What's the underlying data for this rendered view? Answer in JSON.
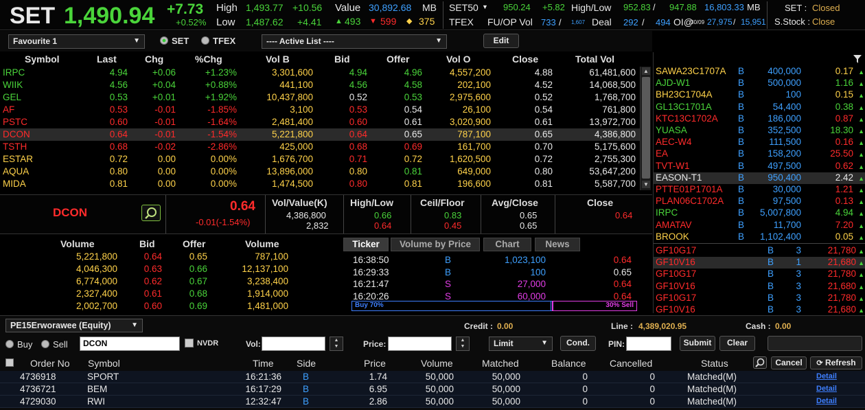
{
  "top": {
    "set_label": "SET",
    "index": "1,490.94",
    "chg": "+7.73",
    "pchg": "+0.52%",
    "high_label": "High",
    "high": "1,493.77",
    "high_chg": "+10.56",
    "low_label": "Low",
    "low": "1,487.62",
    "low_chg": "+4.41",
    "value_label": "Value",
    "value": "30,892.68",
    "mb": "MB",
    "up": "493",
    "down": "599",
    "unch": "375",
    "set50_label": "SET50",
    "set50": "950.24",
    "set50_chg": "+5.82",
    "hl_label": "High/Low",
    "set50_high": "952.83",
    "set50_low": "947.88",
    "set50_value": "16,803.33",
    "set50_mb": "MB",
    "tfex_label": "TFEX",
    "fuop_label": "FU/OP Vol",
    "fuop_vol": "733",
    "fuop_small": "1,607",
    "deal_label": "Deal",
    "deal1": "292",
    "deal2": "494",
    "oi_label": "OI@",
    "oi_date": "30/09",
    "oi1": "27,975",
    "oi2": "15,951",
    "set_status_label": "SET :",
    "set_status": "Closed",
    "sstock_label": "S.Stock :",
    "sstock_status": "Close"
  },
  "toolbar": {
    "favourite": "Favourite 1",
    "set": "SET",
    "tfex": "TFEX",
    "active_list": "---- Active List ----",
    "edit": "Edit"
  },
  "watch": {
    "headers": [
      "Symbol",
      "Last",
      "Chg",
      "%Chg",
      "Vol B",
      "Bid",
      "Offer",
      "Vol O",
      "Close",
      "Total Vol"
    ],
    "rows": [
      {
        "sym": "IRPC",
        "last": "4.94",
        "chg": "+0.06",
        "pchg": "+1.23%",
        "volb": "3,301,600",
        "bid": "4.94",
        "offer": "4.96",
        "volo": "4,557,200",
        "close": "4.88",
        "total": "61,481,600",
        "c": "g",
        "bc": "g",
        "oc": "g"
      },
      {
        "sym": "WIIK",
        "last": "4.56",
        "chg": "+0.04",
        "pchg": "+0.88%",
        "volb": "441,100",
        "bid": "4.56",
        "offer": "4.58",
        "volo": "202,100",
        "close": "4.52",
        "total": "14,068,500",
        "c": "g",
        "bc": "g",
        "oc": "g"
      },
      {
        "sym": "GEL",
        "last": "0.53",
        "chg": "+0.01",
        "pchg": "+1.92%",
        "volb": "10,437,800",
        "bid": "0.52",
        "offer": "0.53",
        "volo": "2,975,600",
        "close": "0.52",
        "total": "1,768,700",
        "c": "g",
        "bc": "w",
        "oc": "g"
      },
      {
        "sym": "AF",
        "last": "0.53",
        "chg": "-0.01",
        "pchg": "-1.85%",
        "volb": "3,100",
        "bid": "0.53",
        "offer": "0.54",
        "volo": "26,100",
        "close": "0.54",
        "total": "761,800",
        "c": "r",
        "bc": "r",
        "oc": "w"
      },
      {
        "sym": "PSTC",
        "last": "0.60",
        "chg": "-0.01",
        "pchg": "-1.64%",
        "volb": "2,481,400",
        "bid": "0.60",
        "offer": "0.61",
        "volo": "3,020,900",
        "close": "0.61",
        "total": "13,972,700",
        "c": "r",
        "bc": "r",
        "oc": "w"
      },
      {
        "sym": "DCON",
        "last": "0.64",
        "chg": "-0.01",
        "pchg": "-1.54%",
        "volb": "5,221,800",
        "bid": "0.64",
        "offer": "0.65",
        "volo": "787,100",
        "close": "0.65",
        "total": "4,386,800",
        "c": "r",
        "bc": "r",
        "oc": "w",
        "hl": true
      },
      {
        "sym": "TSTH",
        "last": "0.68",
        "chg": "-0.02",
        "pchg": "-2.86%",
        "volb": "425,000",
        "bid": "0.68",
        "offer": "0.69",
        "volo": "161,700",
        "close": "0.70",
        "total": "5,175,600",
        "c": "r",
        "bc": "r",
        "oc": "r"
      },
      {
        "sym": "ESTAR",
        "last": "0.72",
        "chg": "0.00",
        "pchg": "0.00%",
        "volb": "1,676,700",
        "bid": "0.71",
        "offer": "0.72",
        "volo": "1,620,500",
        "close": "0.72",
        "total": "2,755,300",
        "c": "y",
        "bc": "r",
        "oc": "y"
      },
      {
        "sym": "AQUA",
        "last": "0.80",
        "chg": "0.00",
        "pchg": "0.00%",
        "volb": "13,896,000",
        "bid": "0.80",
        "offer": "0.81",
        "volo": "649,000",
        "close": "0.80",
        "total": "53,647,200",
        "c": "y",
        "bc": "y",
        "oc": "g"
      },
      {
        "sym": "MIDA",
        "last": "0.81",
        "chg": "0.00",
        "pchg": "0.00%",
        "volb": "1,474,500",
        "bid": "0.80",
        "offer": "0.81",
        "volo": "196,600",
        "close": "0.81",
        "total": "5,587,700",
        "c": "y",
        "bc": "r",
        "oc": "y"
      }
    ]
  },
  "side": {
    "rows": [
      {
        "sym": "SAWA23C1707A",
        "s": "B",
        "vol": "400,000",
        "px": "0.17",
        "c": "y",
        "pc": "y"
      },
      {
        "sym": "AJD-W1",
        "s": "B",
        "vol": "500,000",
        "px": "1.16",
        "c": "g",
        "pc": "g"
      },
      {
        "sym": "BH23C1704A",
        "s": "B",
        "vol": "100",
        "px": "0.15",
        "c": "y",
        "pc": "y"
      },
      {
        "sym": "GL13C1701A",
        "s": "B",
        "vol": "54,400",
        "px": "0.38",
        "c": "g",
        "pc": "g"
      },
      {
        "sym": "KTC13C1702A",
        "s": "B",
        "vol": "186,000",
        "px": "0.87",
        "c": "r",
        "pc": "r"
      },
      {
        "sym": "YUASA",
        "s": "B",
        "vol": "352,500",
        "px": "18.30",
        "c": "g",
        "pc": "g"
      },
      {
        "sym": "AEC-W4",
        "s": "B",
        "vol": "111,500",
        "px": "0.16",
        "c": "r",
        "pc": "r"
      },
      {
        "sym": "EA",
        "s": "B",
        "vol": "158,200",
        "px": "25.50",
        "c": "r",
        "pc": "r"
      },
      {
        "sym": "TVT-W1",
        "s": "B",
        "vol": "497,500",
        "px": "0.62",
        "c": "r",
        "pc": "r"
      },
      {
        "sym": "EASON-T1",
        "s": "B",
        "vol": "950,400",
        "px": "2.42",
        "c": "w",
        "pc": "w",
        "hl": true
      },
      {
        "sym": "PTTE01P1701A",
        "s": "B",
        "vol": "30,000",
        "px": "1.21",
        "c": "r",
        "pc": "r"
      },
      {
        "sym": "PLAN06C1702A",
        "s": "B",
        "vol": "97,500",
        "px": "0.13",
        "c": "r",
        "pc": "r"
      },
      {
        "sym": "IRPC",
        "s": "B",
        "vol": "5,007,800",
        "px": "4.94",
        "c": "g",
        "pc": "g"
      },
      {
        "sym": "AMATAV",
        "s": "B",
        "vol": "11,700",
        "px": "7.20",
        "c": "r",
        "pc": "r"
      },
      {
        "sym": "BROOK",
        "s": "B",
        "vol": "1,102,400",
        "px": "0.05",
        "c": "y",
        "pc": "y"
      }
    ],
    "futures": [
      {
        "sym": "GF10G17",
        "s": "B",
        "vol": "3",
        "px": "21,780"
      },
      {
        "sym": "GF10V16",
        "s": "B",
        "vol": "1",
        "px": "21,680",
        "hl": true
      },
      {
        "sym": "GF10G17",
        "s": "B",
        "vol": "3",
        "px": "21,780"
      },
      {
        "sym": "GF10V16",
        "s": "B",
        "vol": "3",
        "px": "21,680"
      },
      {
        "sym": "GF10G17",
        "s": "B",
        "vol": "3",
        "px": "21,780"
      },
      {
        "sym": "GF10V16",
        "s": "B",
        "vol": "3",
        "px": "21,680"
      }
    ]
  },
  "quote": {
    "symbol": "DCON",
    "last": "0.64",
    "chg": "-0.01(-1.54%)",
    "h_volval": "Vol/Value(K)",
    "volume": "4,386,800",
    "value": "2,832",
    "h_hl": "High/Low",
    "high": "0.66",
    "low": "0.64",
    "h_cf": "Ceil/Floor",
    "ceil": "0.83",
    "floor": "0.45",
    "h_ac": "Avg/Close",
    "avg": "0.65",
    "close_v": "0.65",
    "h_close": "Close",
    "close": "0.64"
  },
  "depth": {
    "headers": [
      "Volume",
      "Bid",
      "Offer",
      "Volume"
    ],
    "rows": [
      {
        "bv": "5,221,800",
        "bid": "0.64",
        "offer": "0.65",
        "ov": "787,100",
        "bc": "r",
        "oc": "y"
      },
      {
        "bv": "4,046,300",
        "bid": "0.63",
        "offer": "0.66",
        "ov": "12,137,100",
        "bc": "r",
        "oc": "g"
      },
      {
        "bv": "6,774,000",
        "bid": "0.62",
        "offer": "0.67",
        "ov": "3,238,400",
        "bc": "r",
        "oc": "g"
      },
      {
        "bv": "2,327,400",
        "bid": "0.61",
        "offer": "0.68",
        "ov": "1,914,000",
        "bc": "r",
        "oc": "g"
      },
      {
        "bv": "2,002,700",
        "bid": "0.60",
        "offer": "0.69",
        "ov": "1,481,000",
        "bc": "r",
        "oc": "g"
      }
    ]
  },
  "ticker": {
    "tabs": [
      "Ticker",
      "Volume by Price",
      "Chart",
      "News"
    ],
    "rows": [
      {
        "time": "16:38:50",
        "side": "B",
        "vol": "1,023,100",
        "px": "0.64",
        "sc": "b",
        "pc": "r"
      },
      {
        "time": "16:29:33",
        "side": "B",
        "vol": "100",
        "px": "0.65",
        "sc": "b",
        "pc": "w"
      },
      {
        "time": "16:21:47",
        "side": "S",
        "vol": "27,000",
        "px": "0.64",
        "sc": "m",
        "pc": "r"
      },
      {
        "time": "16:20:26",
        "side": "S",
        "vol": "60,000",
        "px": "0.64",
        "sc": "m",
        "pc": "r"
      }
    ],
    "buy_label": "Buy",
    "buy_pct": "70%",
    "buy_frac": 0.7,
    "sell_pct": "30%",
    "sell_label": "Sell"
  },
  "order": {
    "account": "PE15Erworawee (Equity)",
    "credit_label": "Credit :",
    "credit": "0.00",
    "line_label": "Line :",
    "line": "4,389,020.95",
    "cash_label": "Cash :",
    "cash": "0.00",
    "buy": "Buy",
    "sell": "Sell",
    "symbol": "DCON",
    "nvdr": "NVDR",
    "vol_label": "Vol:",
    "price_label": "Price:",
    "type": "Limit",
    "cond": "Cond.",
    "pin_label": "PIN:",
    "submit": "Submit",
    "clear": "Clear",
    "headers": [
      "Order No",
      "Symbol",
      "Time",
      "Side",
      "Price",
      "Volume",
      "Matched",
      "Balance",
      "Cancelled",
      "Status"
    ],
    "cancel": "Cancel",
    "refresh": "Refresh",
    "rows": [
      {
        "no": "4736918",
        "sym": "SPORT",
        "time": "16:21:36",
        "side": "B",
        "price": "1.74",
        "vol": "50,000",
        "matched": "50,000",
        "bal": "0",
        "cancelled": "0",
        "status": "Matched(M)",
        "detail": "Detail"
      },
      {
        "no": "4736721",
        "sym": "BEM",
        "time": "16:17:29",
        "side": "B",
        "price": "6.95",
        "vol": "50,000",
        "matched": "50,000",
        "bal": "0",
        "cancelled": "0",
        "status": "Matched(M)",
        "detail": "Detail"
      },
      {
        "no": "4729030",
        "sym": "RWI",
        "time": "12:32:47",
        "side": "B",
        "price": "2.86",
        "vol": "50,000",
        "matched": "50,000",
        "bal": "0",
        "cancelled": "0",
        "status": "Matched(M)",
        "detail": "Detail"
      }
    ]
  }
}
